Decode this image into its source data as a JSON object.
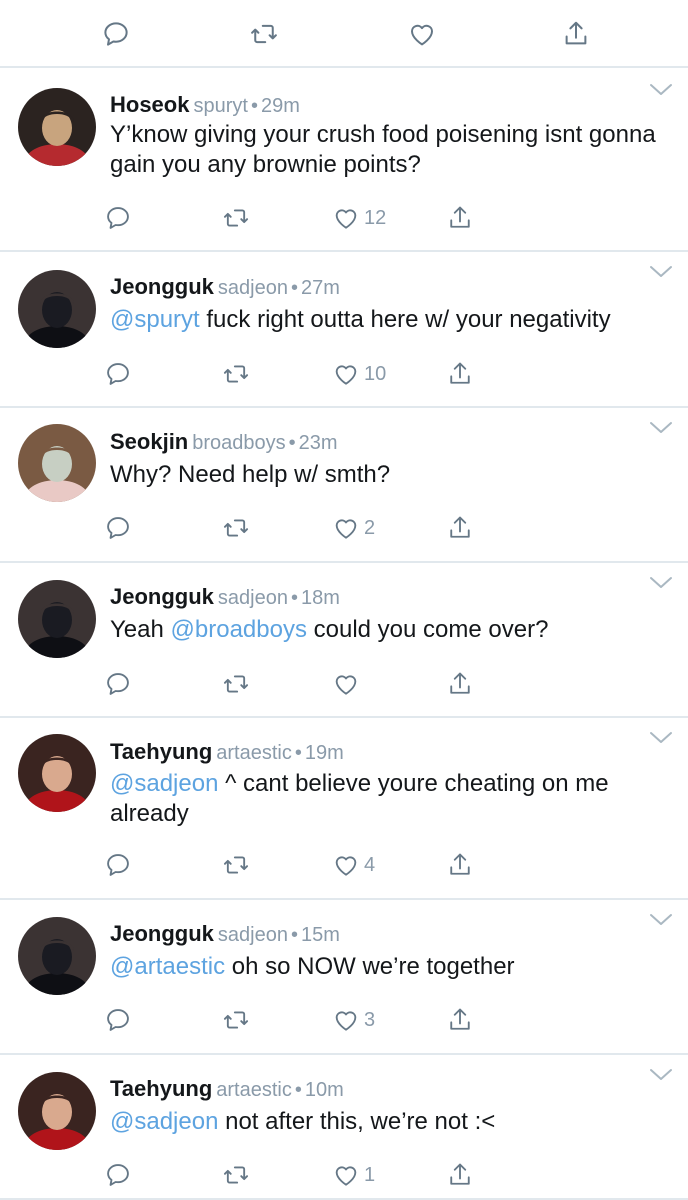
{
  "tweets": [
    {
      "name": "Hoseok",
      "handle": "spuryt",
      "separator": "•",
      "time": "29m",
      "mention": "",
      "text": "Y’know giving your crush food poisening isnt gonna gain you any brownie points?",
      "likes": "12",
      "avatar_colors": [
        "#c8a47e",
        "#2b2320",
        "#b52a2f"
      ]
    },
    {
      "name": "Jeongguk",
      "handle": "sadjeon",
      "separator": "•",
      "time": "27m",
      "mention": "@spuryt",
      "text": " fuck right outta here w/ your negativity",
      "likes": "10",
      "avatar_colors": [
        "#1a1b22",
        "#3b3333",
        "#0e0f14"
      ]
    },
    {
      "name": "Seokjin",
      "handle": "broadboys",
      "separator": "•",
      "time": "23m",
      "mention": "",
      "text": "Why? Need help w/ smth?",
      "likes": "2",
      "avatar_colors": [
        "#c7cfc3",
        "#7a5a43",
        "#e9c9c5"
      ]
    },
    {
      "name": "Jeongguk",
      "handle": "sadjeon",
      "separator": "•",
      "time": "18m",
      "prefix": "Yeah ",
      "mention": "@broadboys",
      "text": " could you come over?",
      "likes": "",
      "avatar_colors": [
        "#1a1b22",
        "#3b3333",
        "#0e0f14"
      ]
    },
    {
      "name": "Taehyung",
      "handle": "artaestic",
      "separator": "•",
      "time": "19m",
      "mention": "@sadjeon",
      "text": " ^ cant believe youre cheating on me already",
      "likes": "4",
      "avatar_colors": [
        "#d9a98e",
        "#3a2420",
        "#b0141a"
      ]
    },
    {
      "name": "Jeongguk",
      "handle": "sadjeon",
      "separator": "•",
      "time": "15m",
      "mention": "@artaestic",
      "text": " oh so NOW we’re together",
      "likes": "3",
      "avatar_colors": [
        "#1a1b22",
        "#3b3333",
        "#0e0f14"
      ]
    },
    {
      "name": "Taehyung",
      "handle": "artaestic",
      "separator": "•",
      "time": "10m",
      "mention": "@sadjeon",
      "text": " not after this, we’re not :<",
      "likes": "1",
      "avatar_colors": [
        "#d9a98e",
        "#3a2420",
        "#b0141a"
      ]
    }
  ],
  "icons": {
    "reply": "reply-icon",
    "retweet": "retweet-icon",
    "like": "heart-icon",
    "share": "share-icon",
    "more": "chevron-down-icon"
  },
  "colors": {
    "mention": "#5da3e0",
    "muted": "#8a9aa9",
    "divider": "#e1e8ed",
    "icon": "#657786"
  }
}
